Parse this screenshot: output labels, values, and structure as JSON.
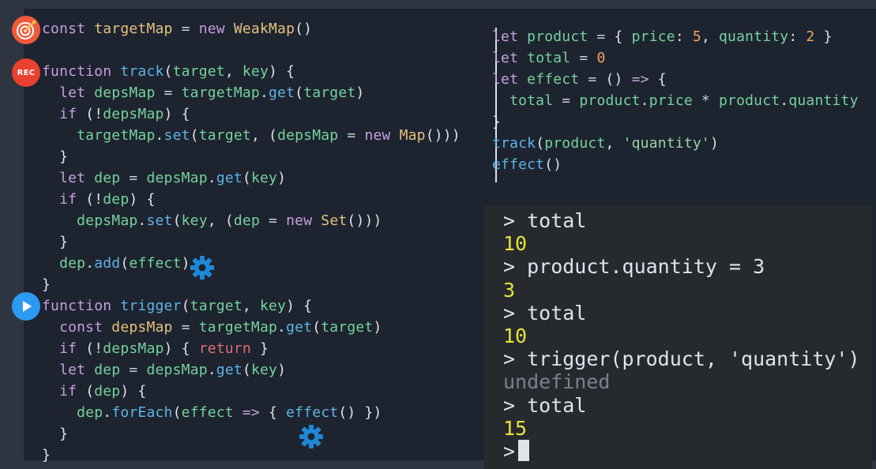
{
  "icons": {
    "target": "target-icon",
    "rec": "record-icon",
    "play": "play-icon",
    "gear": "gear-icon",
    "rec_label": "REC"
  },
  "colors": {
    "background": "#1d2430",
    "console_background": "#262a2f",
    "keyword": "#c79fe0",
    "return_keyword": "#e06c75",
    "variable": "#e5c07b",
    "identifier": "#76d29b",
    "function": "#5fb3e6",
    "number": "#f0a35e",
    "console_result": "#e8e23a",
    "console_undefined": "#7b8088",
    "gear": "#1e88d6",
    "play_badge": "#2b9af3",
    "rec_badge": "#e9402f"
  },
  "left_code": [
    [
      [
        "t-kw",
        "const "
      ],
      [
        "t-var",
        "targetMap"
      ],
      [
        "t-op",
        " = "
      ],
      [
        "t-kw",
        "new "
      ],
      [
        "t-var",
        "WeakMap"
      ],
      [
        "t-p",
        "()"
      ]
    ],
    [],
    [
      [
        "t-kw",
        "function "
      ],
      [
        "t-fn",
        "track"
      ],
      [
        "t-p",
        "("
      ],
      [
        "t-id",
        "target"
      ],
      [
        "t-p",
        ", "
      ],
      [
        "t-id",
        "key"
      ],
      [
        "t-p",
        ") {"
      ]
    ],
    [
      [
        "t-kw",
        "  let "
      ],
      [
        "t-id",
        "depsMap"
      ],
      [
        "t-op",
        " = "
      ],
      [
        "t-id",
        "targetMap"
      ],
      [
        "t-p",
        "."
      ],
      [
        "t-fn",
        "get"
      ],
      [
        "t-p",
        "("
      ],
      [
        "t-id",
        "target"
      ],
      [
        "t-p",
        ")"
      ]
    ],
    [
      [
        "t-kw",
        "  if "
      ],
      [
        "t-p",
        "(!"
      ],
      [
        "t-id",
        "depsMap"
      ],
      [
        "t-p",
        ") {"
      ]
    ],
    [
      [
        "t-id",
        "    targetMap"
      ],
      [
        "t-p",
        "."
      ],
      [
        "t-fn",
        "set"
      ],
      [
        "t-p",
        "("
      ],
      [
        "t-id",
        "target"
      ],
      [
        "t-p",
        ", ("
      ],
      [
        "t-id",
        "depsMap"
      ],
      [
        "t-op",
        " = "
      ],
      [
        "t-kw",
        "new "
      ],
      [
        "t-var",
        "Map"
      ],
      [
        "t-p",
        "()))"
      ]
    ],
    [
      [
        "t-p",
        "  }"
      ]
    ],
    [
      [
        "t-kw",
        "  let "
      ],
      [
        "t-id",
        "dep"
      ],
      [
        "t-op",
        " = "
      ],
      [
        "t-id",
        "depsMap"
      ],
      [
        "t-p",
        "."
      ],
      [
        "t-fn",
        "get"
      ],
      [
        "t-p",
        "("
      ],
      [
        "t-id",
        "key"
      ],
      [
        "t-p",
        ")"
      ]
    ],
    [
      [
        "t-kw",
        "  if "
      ],
      [
        "t-p",
        "(!"
      ],
      [
        "t-id",
        "dep"
      ],
      [
        "t-p",
        ") {"
      ]
    ],
    [
      [
        "t-id",
        "    depsMap"
      ],
      [
        "t-p",
        "."
      ],
      [
        "t-fn",
        "set"
      ],
      [
        "t-p",
        "("
      ],
      [
        "t-id",
        "key"
      ],
      [
        "t-p",
        ", ("
      ],
      [
        "t-id",
        "dep"
      ],
      [
        "t-op",
        " = "
      ],
      [
        "t-kw",
        "new "
      ],
      [
        "t-var",
        "Set"
      ],
      [
        "t-p",
        "()))"
      ]
    ],
    [
      [
        "t-p",
        "  }"
      ]
    ],
    [
      [
        "t-id",
        "  dep"
      ],
      [
        "t-p",
        "."
      ],
      [
        "t-fn",
        "add"
      ],
      [
        "t-p",
        "("
      ],
      [
        "t-id",
        "effect"
      ],
      [
        "t-p",
        ")"
      ]
    ],
    [
      [
        "t-p",
        "}"
      ]
    ],
    [
      [
        "t-kw",
        "function "
      ],
      [
        "t-fn",
        "trigger"
      ],
      [
        "t-p",
        "("
      ],
      [
        "t-id",
        "target"
      ],
      [
        "t-p",
        ", "
      ],
      [
        "t-id",
        "key"
      ],
      [
        "t-p",
        ") {"
      ]
    ],
    [
      [
        "t-kw",
        "  const "
      ],
      [
        "t-var",
        "depsMap"
      ],
      [
        "t-op",
        " = "
      ],
      [
        "t-id",
        "targetMap"
      ],
      [
        "t-p",
        "."
      ],
      [
        "t-fn",
        "get"
      ],
      [
        "t-p",
        "("
      ],
      [
        "t-id",
        "target"
      ],
      [
        "t-p",
        ")"
      ]
    ],
    [
      [
        "t-kw",
        "  if "
      ],
      [
        "t-p",
        "(!"
      ],
      [
        "t-id",
        "depsMap"
      ],
      [
        "t-p",
        ") { "
      ],
      [
        "t-kw2",
        "return"
      ],
      [
        "t-p",
        " }"
      ]
    ],
    [
      [
        "t-kw",
        "  let "
      ],
      [
        "t-id",
        "dep"
      ],
      [
        "t-op",
        " = "
      ],
      [
        "t-id",
        "depsMap"
      ],
      [
        "t-p",
        "."
      ],
      [
        "t-fn",
        "get"
      ],
      [
        "t-p",
        "("
      ],
      [
        "t-id",
        "key"
      ],
      [
        "t-p",
        ")"
      ]
    ],
    [
      [
        "t-kw",
        "  if "
      ],
      [
        "t-p",
        "("
      ],
      [
        "t-id",
        "dep"
      ],
      [
        "t-p",
        ") {"
      ]
    ],
    [
      [
        "t-id",
        "    dep"
      ],
      [
        "t-p",
        "."
      ],
      [
        "t-fn",
        "forEach"
      ],
      [
        "t-p",
        "("
      ],
      [
        "t-id",
        "effect"
      ],
      [
        "t-kw",
        " => "
      ],
      [
        "t-p",
        "{ "
      ],
      [
        "t-fn",
        "effect"
      ],
      [
        "t-p",
        "() })"
      ]
    ],
    [
      [
        "t-p",
        "  }"
      ]
    ],
    [
      [
        "t-p",
        "}"
      ]
    ]
  ],
  "right_code": [
    [
      [
        "t-kw",
        "let "
      ],
      [
        "t-id",
        "product"
      ],
      [
        "t-op",
        " = "
      ],
      [
        "t-p",
        "{ "
      ],
      [
        "t-id",
        "price"
      ],
      [
        "t-p",
        ": "
      ],
      [
        "t-num",
        "5"
      ],
      [
        "t-p",
        ", "
      ],
      [
        "t-id",
        "quantity"
      ],
      [
        "t-p",
        ": "
      ],
      [
        "t-num",
        "2"
      ],
      [
        "t-p",
        " }"
      ]
    ],
    [
      [
        "t-kw",
        "let "
      ],
      [
        "t-id",
        "total"
      ],
      [
        "t-op",
        " = "
      ],
      [
        "t-num",
        "0"
      ]
    ],
    [
      [
        "t-kw",
        "let "
      ],
      [
        "t-id",
        "effect"
      ],
      [
        "t-op",
        " = "
      ],
      [
        "t-p",
        "() "
      ],
      [
        "t-kw",
        "=>"
      ],
      [
        "t-p",
        " {"
      ]
    ],
    [
      [
        "t-id",
        "  total"
      ],
      [
        "t-op",
        " = "
      ],
      [
        "t-id",
        "product"
      ],
      [
        "t-p",
        "."
      ],
      [
        "t-id",
        "price"
      ],
      [
        "t-op",
        " * "
      ],
      [
        "t-id",
        "product"
      ],
      [
        "t-p",
        "."
      ],
      [
        "t-id",
        "quantity"
      ]
    ],
    [
      [
        "t-p",
        "}"
      ]
    ],
    [
      [
        "t-fn",
        "track"
      ],
      [
        "t-p",
        "("
      ],
      [
        "t-id",
        "product"
      ],
      [
        "t-p",
        ", "
      ],
      [
        "t-str",
        "'quantity'"
      ],
      [
        "t-p",
        ")"
      ]
    ],
    [
      [
        "t-fn",
        "effect"
      ],
      [
        "t-p",
        "()"
      ]
    ]
  ],
  "console": {
    "lines": [
      {
        "kind": "cmd",
        "text": "> total"
      },
      {
        "kind": "res",
        "text": "10"
      },
      {
        "kind": "cmd",
        "text": "> product.quantity = 3"
      },
      {
        "kind": "res",
        "text": "3"
      },
      {
        "kind": "cmd",
        "text": "> total"
      },
      {
        "kind": "res",
        "text": "10"
      },
      {
        "kind": "cmd",
        "text": "> trigger(product, 'quantity')"
      },
      {
        "kind": "undef",
        "text": "undefined"
      },
      {
        "kind": "cmd",
        "text": "> total"
      },
      {
        "kind": "res",
        "text": "15"
      }
    ],
    "prompt": ">"
  }
}
